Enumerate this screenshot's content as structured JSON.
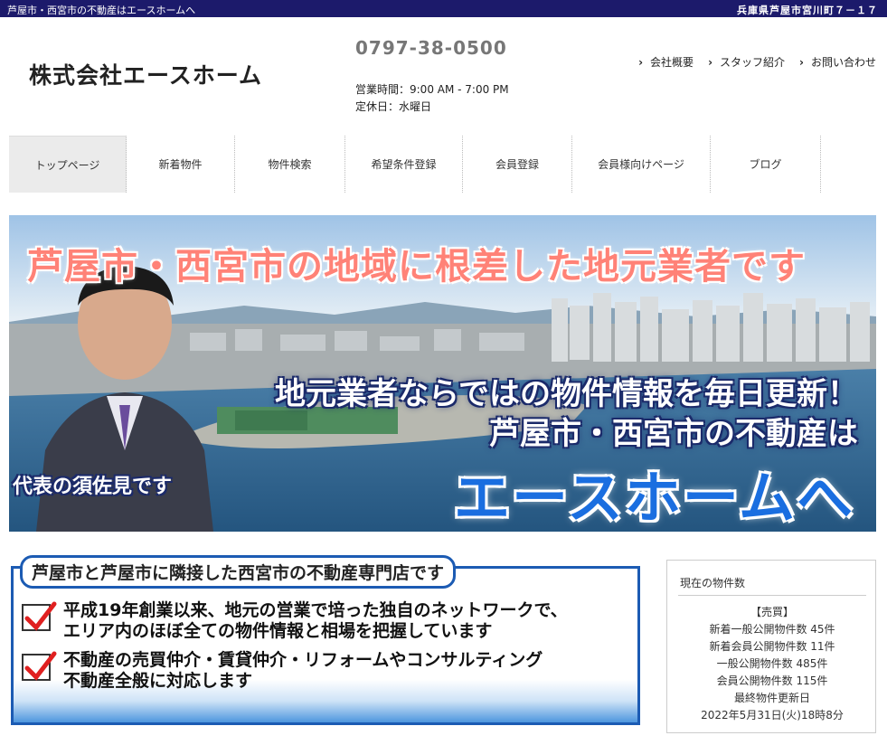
{
  "topbar": {
    "tagline": "芦屋市・西宮市の不動産はエースホームへ",
    "address": "兵庫県芦屋市宮川町７－１７"
  },
  "header": {
    "company": "株式会社エースホーム",
    "phone": "0797-38-0500",
    "hours": "営業時間：9:00 AM - 7:00 PM",
    "closed": "定休日：水曜日",
    "links": [
      "会社概要",
      "スタッフ紹介",
      "お問い合わせ"
    ]
  },
  "nav": {
    "items": [
      "トップページ",
      "新着物件",
      "物件検索",
      "希望条件登録",
      "会員登録",
      "会員様向けページ",
      "ブログ"
    ]
  },
  "hero": {
    "line1": "芦屋市・西宮市の地域に根差した地元業者です",
    "line2": "地元業者ならではの物件情報を毎日更新！",
    "line3": "芦屋市・西宮市の不動産は",
    "line4": "エースホームへ",
    "rep": "代表の須佐見です"
  },
  "intro": {
    "title": "芦屋市と芦屋市に隣接した西宮市の不動産専門店です",
    "points": [
      {
        "l1": "平成19年創業以来、地元の営業で培った独自のネットワークで、",
        "l2": "エリア内のほぼ全ての物件情報と相場を把握しています"
      },
      {
        "l1": "不動産の売買仲介・賃貸仲介・リフォームやコンサルティング",
        "l2": "不動産全般に対応します"
      }
    ]
  },
  "widget": {
    "title": "現在の物件数",
    "lines": [
      "【売買】",
      "新着一般公開物件数 45件",
      "新着会員公開物件数 11件",
      "一般公開物件数 485件",
      "会員公開物件数 115件",
      "最終物件更新日",
      "2022年5月31日(火)18時8分"
    ]
  },
  "colors": {
    "topbar": "#1c1a6b",
    "accent_blue": "#1c5bb3",
    "hero_red": "#ff8277",
    "hero_blue": "#1a6ee0"
  }
}
